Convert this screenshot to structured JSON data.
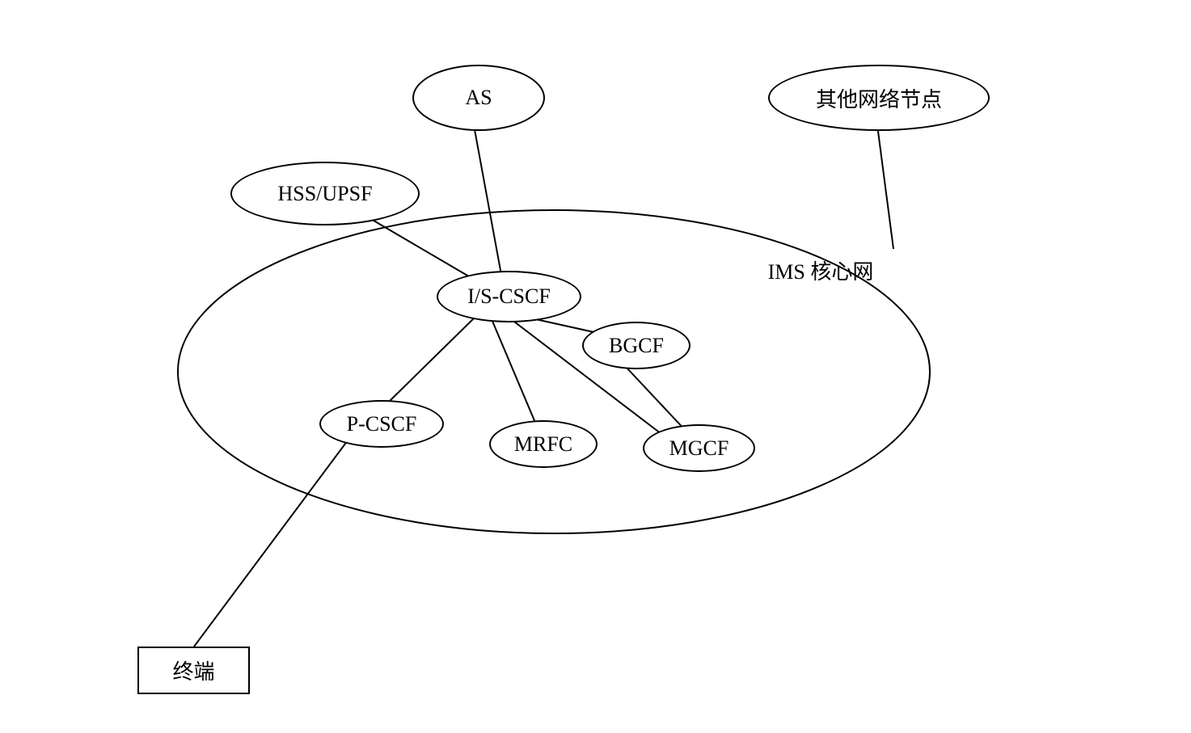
{
  "nodes": {
    "as": "AS",
    "other_network": "其他网络节点",
    "hss_upsf": "HSS/UPSF",
    "is_cscf": "I/S-CSCF",
    "bgcf": "BGCF",
    "p_cscf": "P-CSCF",
    "mrfc": "MRFC",
    "mgcf": "MGCF",
    "terminal": "终端"
  },
  "labels": {
    "ims_core": "IMS 核心网"
  }
}
